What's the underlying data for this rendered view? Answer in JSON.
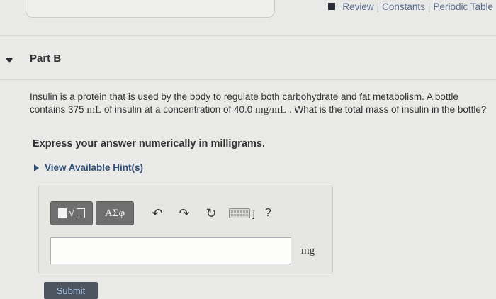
{
  "header": {
    "links": [
      {
        "label": "Review"
      },
      {
        "label": "Constants"
      },
      {
        "label": "Periodic Table"
      }
    ],
    "separator": "|"
  },
  "part": {
    "title": "Part B"
  },
  "question": {
    "text_1": "Insulin is a protein that is used by the body to regulate both carbohydrate and fat metabolism. A bottle contains 375 ",
    "unit_1": "mL",
    "text_2": " of insulin at a concentration of 40.0 ",
    "unit_2": "mg/mL",
    "text_3": " . What is the total mass of insulin in the bottle?",
    "instruction": "Express your answer numerically in milligrams.",
    "hint_label": "View Available Hint(s)"
  },
  "toolbar": {
    "template_symbol": "√",
    "greek_label": "ΑΣφ",
    "undo_symbol": "↶",
    "redo_symbol": "↷",
    "reset_symbol": "↻",
    "keyboard_suffix": "]",
    "help_label": "?"
  },
  "answer": {
    "value": "",
    "unit": "mg"
  },
  "submit_label": "Submit"
}
